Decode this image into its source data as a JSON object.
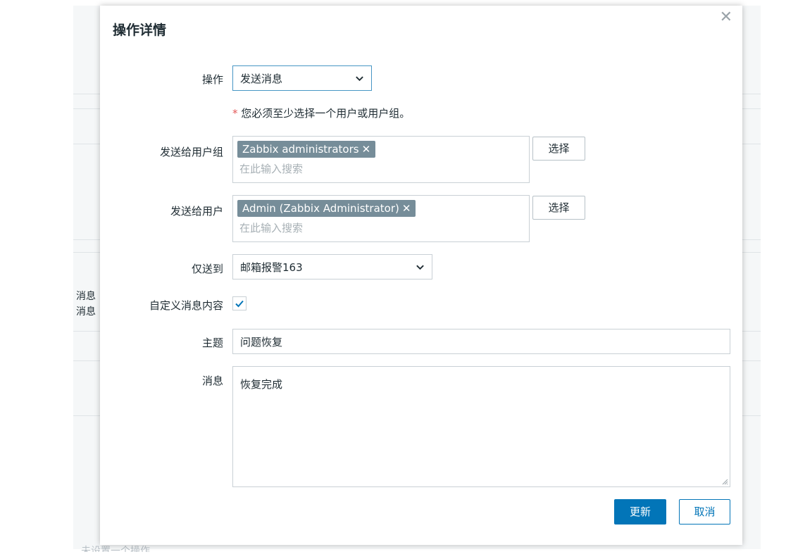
{
  "background": {
    "left_fragments": [
      "消息",
      "消息"
    ],
    "bottom_fragment": "未设置一个操作"
  },
  "dialog": {
    "title": "操作详情",
    "close_icon": "close-icon",
    "operation": {
      "label": "操作",
      "value": "发送消息"
    },
    "requirement": {
      "star": "*",
      "text": "您必须至少选择一个用户或用户组。"
    },
    "send_to_groups": {
      "label": "发送给用户组",
      "tags": [
        "Zabbix administrators"
      ],
      "placeholder": "在此输入搜索",
      "select_button": "选择"
    },
    "send_to_users": {
      "label": "发送给用户",
      "tags": [
        "Admin (Zabbix Administrator)"
      ],
      "placeholder": "在此输入搜索",
      "select_button": "选择"
    },
    "send_only_to": {
      "label": "仅送到",
      "value": "邮箱报警163"
    },
    "custom_message": {
      "label": "自定义消息内容",
      "checked": true
    },
    "subject": {
      "label": "主题",
      "value": "问题恢复"
    },
    "message": {
      "label": "消息",
      "value": "恢复完成"
    },
    "buttons": {
      "update": "更新",
      "cancel": "取消"
    }
  },
  "colors": {
    "primary": "#0275b8",
    "tag_bg": "#768d99",
    "required_star": "#e45959"
  }
}
